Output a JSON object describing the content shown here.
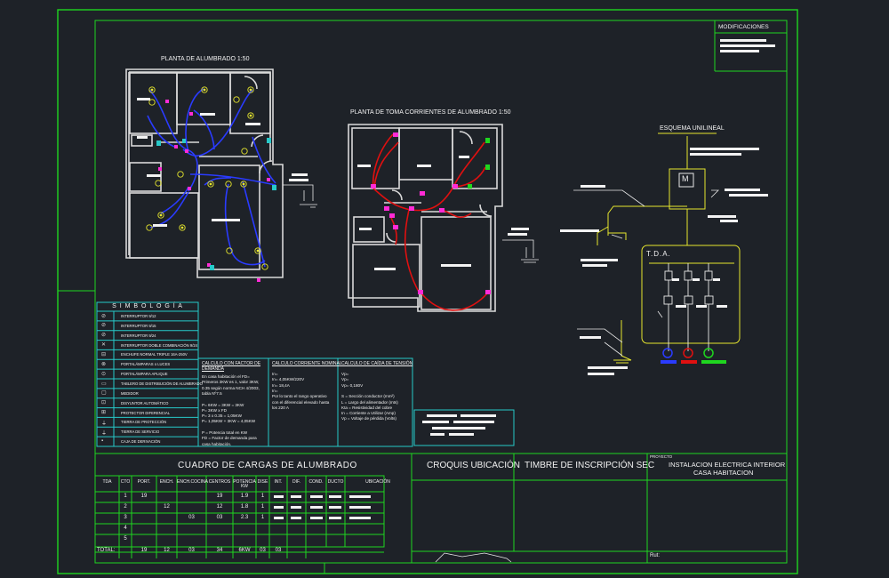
{
  "modificaciones": "MODIFICACIONES",
  "plans": {
    "alumbrado_title": "PLANTA DE ALUMBRADO 1:50",
    "tomas_title": "PLANTA DE TOMA CORRIENTES DE ALUMBRADO 1:50",
    "esquema_title": "ESQUEMA UNILINEAL",
    "tda_label": "T.D.A.",
    "motor_label": "M"
  },
  "simbologia": {
    "title": "S I M B O L O G Í A",
    "items": [
      "INTERRUPTOR 9/12",
      "INTERRUPTOR 9/15",
      "INTERRUPTOR 9/24",
      "INTERRUPTOR DOBLE COMBINACIÓN 9/24",
      "ENCHUFE NORMAL TRIPLE 16A-250V",
      "PORTALÁMPARAS o LUCES",
      "PORTALÁMPARA APLIQUE",
      "TABLERO DE DISTRIBUCIÓN DE ALUMBRADO",
      "MEDIDOR",
      "DISYUNTOR AUTOMÁTICO",
      "PROTECTOR DIFERENCIAL",
      "TIERRA DE PROTECCIÓN",
      "TIERRA DE SERVICIO",
      "CAJA DE DERIVACIÓN"
    ]
  },
  "calculos": {
    "col1_title": "CALCULO CON FACTOR DE DEMANDA",
    "col1_lines": [
      "En casa habitación el FD=",
      "Primeros 3KW es 1, valor 3KW,",
      "0.35 según norma NCH 4/2003,",
      "tabla Nº7.5",
      "",
      "P= 6KW = 3KW = 3KW",
      "P= 3KW x FD",
      "P= 3 x 0.35 = 1,05KW",
      "P= 1,05KW + 3KW = 4,05KW",
      "",
      "P = Potencia total en KW",
      "FD = Factor de demanda para",
      "casa habitación."
    ],
    "col2_title": "CALCULO CORRIENTE NOMINAL",
    "col2_lines": [
      "In=",
      "In= 4,05KW/220V",
      "In= 18,4A",
      "In=",
      "Por lo tanto el rango operativo",
      "con el diferencial elevado hasta",
      "los 220 A"
    ],
    "col3_title": "CALCULO DE CAÍDA DE TENSIÓN",
    "col3_lines": [
      "Vp=",
      "Vp=",
      "Vp= 0,180V",
      "",
      "S = Sección conductor (mm²)",
      "L = Largo del alimentador (mts)",
      "Kta = Resistividad del cobre",
      "In = Corriente a Utilizar (Amp)",
      "Vp = Voltaje de pérdida (Volts)"
    ]
  },
  "cuadro": {
    "title": "CUADRO DE CARGAS DE ALUMBRADO",
    "headers": [
      "TDA",
      "CTO",
      "PORT.",
      "ENCH.",
      "ENCH.COCINA",
      "CENTROS",
      "POTENCIA KW",
      "DISE",
      "INT.",
      "DIF.",
      "COND.",
      "DUCTO",
      "UBICACIÓN"
    ],
    "rows": [
      [
        "",
        "1",
        "19",
        "",
        "",
        "19",
        "1.9",
        "1"
      ],
      [
        "",
        "2",
        "",
        "12",
        "",
        "12",
        "1.8",
        "1"
      ],
      [
        "",
        "3",
        "",
        "",
        "03",
        "03",
        "2.3",
        "1"
      ],
      [
        "",
        "4",
        "",
        "",
        "",
        "",
        "",
        ""
      ],
      [
        "",
        "5",
        "",
        "",
        "",
        "",
        "",
        ""
      ]
    ],
    "total": [
      "TOTAL:",
      "",
      "19",
      "12",
      "03",
      "34",
      "6KW",
      "03",
      "03"
    ]
  },
  "title_block": {
    "croquis": "CROQUIS UBICACIÓN",
    "timbre": "TIMBRE DE INSCRIPCIÓN SEC",
    "proyecto_label": "PROYECTO",
    "proyecto_l1": "INSTALACION ELECTRICA INTERIOR",
    "proyecto_l2": "CASA HABITACION",
    "rut_label": "Rut:"
  },
  "colors": {
    "frame": "#1fd61f",
    "table": "#27c9c9",
    "wiring": "#2a3bff",
    "outlet_wiring": "#e01010",
    "schematic": "#e6e62e",
    "background": "#1e2228"
  }
}
